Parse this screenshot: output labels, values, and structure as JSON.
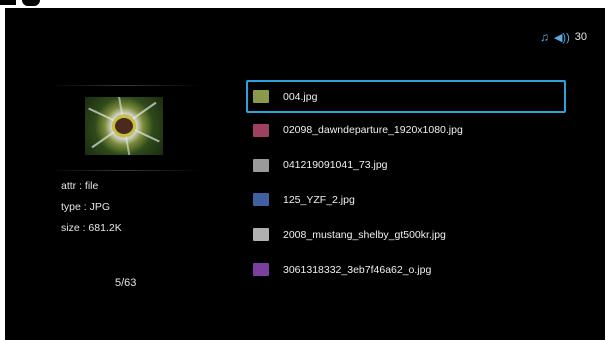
{
  "status": {
    "music_icon": "music-note-icon",
    "volume_icon": "speaker-icon",
    "volume_value": "30"
  },
  "preview": {
    "attr": "attr : file",
    "type": "type : JPG",
    "size": "size : 681.2K",
    "counter": "5/63"
  },
  "files": [
    {
      "name": "004.jpg",
      "selected": true,
      "icon_color": "#8a9a4a"
    },
    {
      "name": "02098_dawndeparture_1920x1080.jpg",
      "selected": false,
      "icon_color": "#a04060"
    },
    {
      "name": "041219091041_73.jpg",
      "selected": false,
      "icon_color": "#9a9a9a"
    },
    {
      "name": "125_YZF_2.jpg",
      "selected": false,
      "icon_color": "#4060a0"
    },
    {
      "name": "2008_mustang_shelby_gt500kr.jpg",
      "selected": false,
      "icon_color": "#b0b0b0"
    },
    {
      "name": "3061318332_3eb7f46a62_o.jpg",
      "selected": false,
      "icon_color": "#7a40a0"
    }
  ],
  "colors": {
    "background": "#000000",
    "selection": "#29a3d9",
    "accent": "#5aa9e6",
    "text": "#f0f0f0"
  }
}
